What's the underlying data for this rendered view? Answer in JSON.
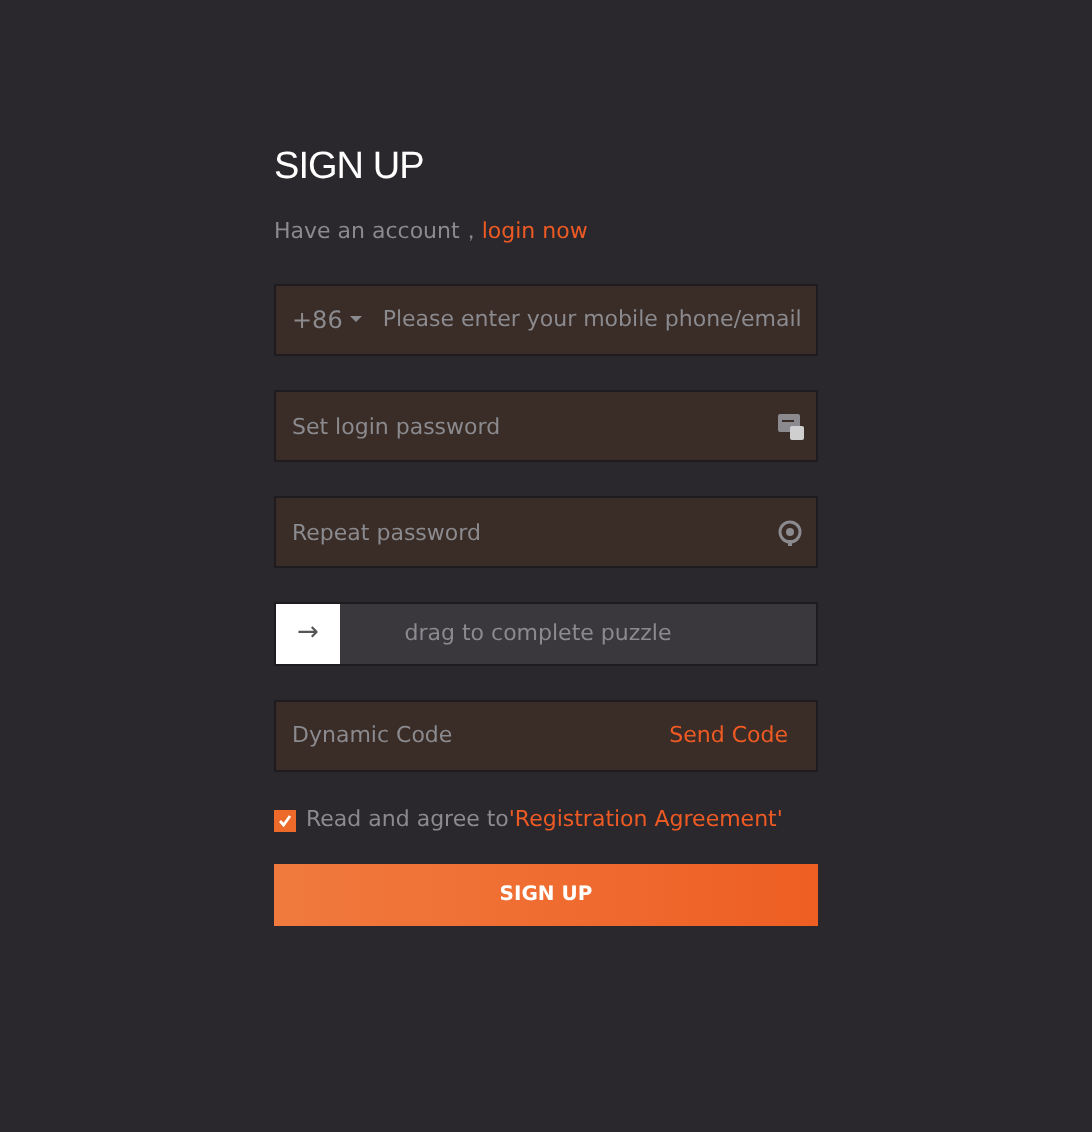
{
  "title": "SIGN UP",
  "account_prompt": {
    "text": "Have an account，",
    "link": "login now"
  },
  "phone": {
    "country_code": "+86",
    "placeholder": "Please enter your mobile phone/email"
  },
  "password": {
    "placeholder": "Set login password"
  },
  "repeat_password": {
    "placeholder": "Repeat password"
  },
  "puzzle": {
    "arrow": "→",
    "level": 0,
    "label": "drag to complete puzzle"
  },
  "dynamic_code": {
    "placeholder": "Dynamic Code",
    "button": "Send Code"
  },
  "agreement": {
    "checked": true,
    "text": "Read and agree to",
    "link": "'Registration Agreement'"
  },
  "submit": "SIGN UP"
}
